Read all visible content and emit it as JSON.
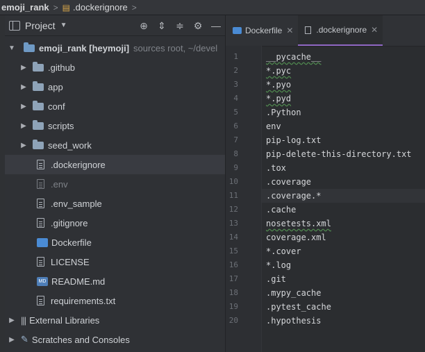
{
  "breadcrumb": {
    "project": "emoji_rank",
    "separator": ">",
    "file": ".dockerignore"
  },
  "project_panel": {
    "title": "Project",
    "tools": [
      "target-icon",
      "expand-all-icon",
      "collapse-all-icon",
      "gear-icon",
      "minimize-icon"
    ]
  },
  "tree": {
    "root": {
      "name": "emoji_rank [heymoji]",
      "hint": "sources root,  ~/devel"
    },
    "items": [
      {
        "label": ".github",
        "kind": "folder"
      },
      {
        "label": "app",
        "kind": "folder"
      },
      {
        "label": "conf",
        "kind": "folder"
      },
      {
        "label": "scripts",
        "kind": "folder"
      },
      {
        "label": "seed_work",
        "kind": "folder"
      },
      {
        "label": ".dockerignore",
        "kind": "file",
        "selected": true
      },
      {
        "label": ".env",
        "kind": "file",
        "dim": true
      },
      {
        "label": ".env_sample",
        "kind": "file"
      },
      {
        "label": ".gitignore",
        "kind": "file"
      },
      {
        "label": "Dockerfile",
        "kind": "docker"
      },
      {
        "label": "LICENSE",
        "kind": "file"
      },
      {
        "label": "README.md",
        "kind": "md"
      },
      {
        "label": "requirements.txt",
        "kind": "file"
      }
    ],
    "external": "External Libraries",
    "scratches": "Scratches and Consoles",
    "md_badge": "MD"
  },
  "tabs": [
    {
      "label": "Dockerfile",
      "active": false
    },
    {
      "label": ".dockerignore",
      "active": true
    }
  ],
  "editor": {
    "current_line": 11,
    "lines": [
      "__pycache__",
      "*.pyc",
      "*.pyo",
      "*.pyd",
      ".Python",
      "env",
      "pip-log.txt",
      "pip-delete-this-directory.txt",
      ".tox",
      ".coverage",
      ".coverage.*",
      ".cache",
      "nosetests.xml",
      "coverage.xml",
      "*.cover",
      "*.log",
      ".git",
      ".mypy_cache",
      ".pytest_cache",
      ".hypothesis"
    ]
  },
  "colors": {
    "selection": "#393b41",
    "tab_accent": "#9068c4",
    "folder": "#8ea3b8"
  }
}
